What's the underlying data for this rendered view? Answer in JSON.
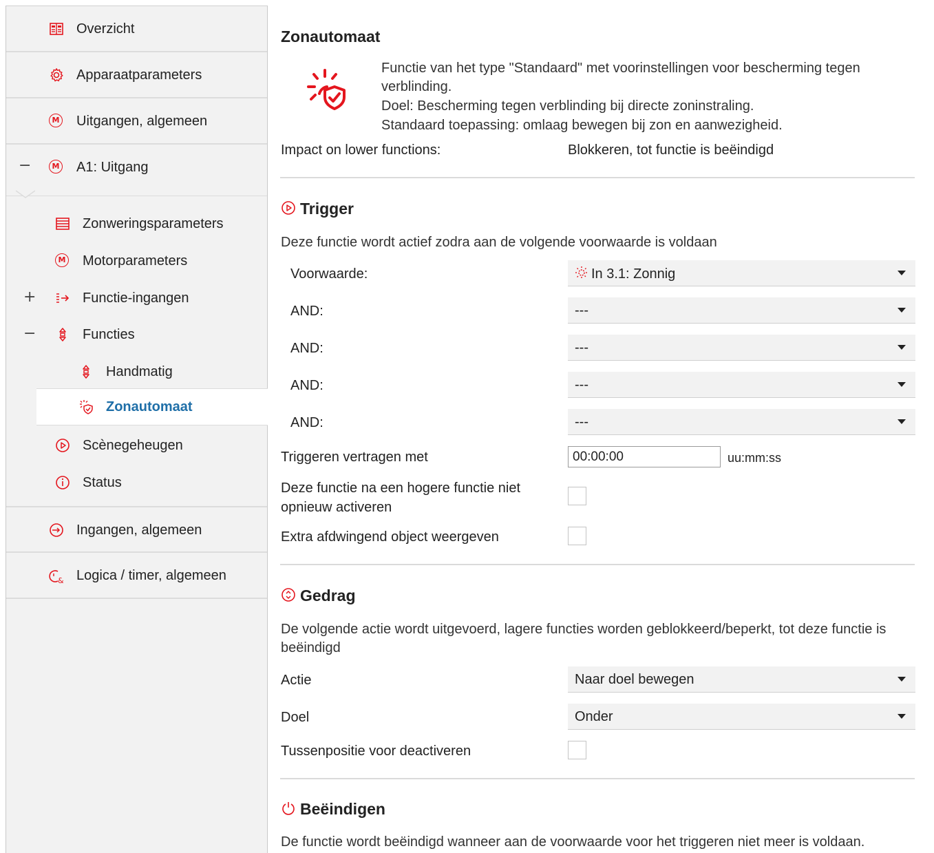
{
  "sidebar": {
    "top_items": [
      {
        "label": "Overzicht",
        "icon": "overview-icon"
      },
      {
        "label": "Apparaatparameters",
        "icon": "gear-icon"
      },
      {
        "label": "Uitgangen, algemeen",
        "icon": "motor-icon"
      },
      {
        "label": "A1: Uitgang",
        "icon": "motor-icon",
        "toggle": "−"
      }
    ],
    "sub_items": [
      {
        "label": "Zonweringsparameters",
        "icon": "blind-icon"
      },
      {
        "label": "Motorparameters",
        "icon": "motor-icon"
      },
      {
        "label": "Functie-ingangen",
        "icon": "function-input-icon",
        "toggle": "+"
      },
      {
        "label": "Functies",
        "icon": "functions-icon",
        "toggle": "−"
      },
      {
        "label": "Handmatig",
        "icon": "manual-icon"
      },
      {
        "label": "Zonautomaat",
        "icon": "sun-shield-icon",
        "selected": true
      },
      {
        "label": "Scènegeheugen",
        "icon": "scene-icon"
      },
      {
        "label": "Status",
        "icon": "info-icon"
      }
    ],
    "bottom_items": [
      {
        "label": "Ingangen, algemeen",
        "icon": "input-icon"
      },
      {
        "label": "Logica / timer, algemeen",
        "icon": "logic-timer-icon"
      }
    ]
  },
  "main": {
    "title": "Zonautomaat",
    "description": [
      "Functie van het type \"Standaard\" met voorinstellingen voor bescherming tegen",
      "verblinding.",
      "Doel: Bescherming tegen verblinding bij directe zoninstraling.",
      "Standaard toepassing: omlaag bewegen bij zon en aanwezigheid."
    ],
    "impact_label": "Impact on lower functions:",
    "impact_value": "Blokkeren, tot functie is beëindigd",
    "trigger": {
      "heading": "Trigger",
      "intro": "Deze functie wordt actief zodra aan de volgende voorwaarde is voldaan",
      "condition_label": "Voorwaarde:",
      "condition_value": "In 3.1: Zonnig",
      "and_label": "AND:",
      "and_values": [
        "---",
        "---",
        "---",
        "---"
      ],
      "delay_label": "Triggeren vertragen met",
      "delay_value": "00:00:00",
      "delay_unit": "uu:mm:ss",
      "no_reactivate_label_1": "Deze functie na een hogere functie niet",
      "no_reactivate_label_2": "opnieuw activeren",
      "extra_object_label": "Extra afdwingend object weergeven"
    },
    "behavior": {
      "heading": "Gedrag",
      "intro_1": "De volgende actie wordt uitgevoerd, lagere functies worden geblokkeerd/beperkt, tot deze functie is",
      "intro_2": "beëindigd",
      "action_label": "Actie",
      "action_value": "Naar doel bewegen",
      "target_label": "Doel",
      "target_value": "Onder",
      "intermediate_label": "Tussenpositie voor deactiveren"
    },
    "end": {
      "heading": "Beëindigen",
      "intro": "De functie wordt beëindigd wanneer aan de voorwaarde voor het triggeren niet meer is voldaan."
    }
  },
  "colors": {
    "accent": "#e4161e",
    "selected_text": "#1f6fa8",
    "sidebar_bg": "#f2f2f2",
    "dropdown_bg": "#f2f2f2"
  }
}
